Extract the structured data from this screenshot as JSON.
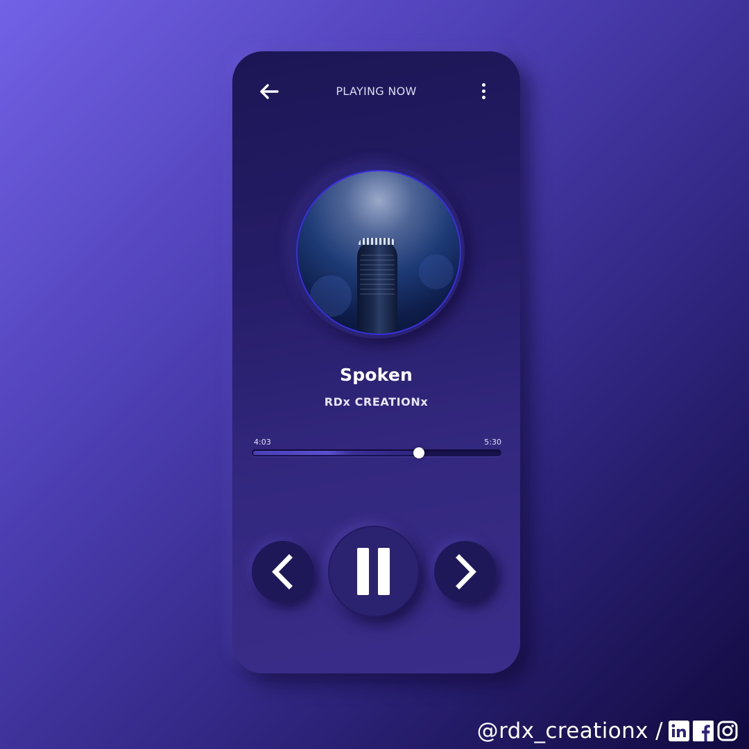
{
  "header": {
    "back_icon": "arrow-left-icon",
    "title": "PLAYING NOW",
    "menu_icon": "more-vertical-icon"
  },
  "track": {
    "title": "Spoken",
    "artist": "RDx CREATIONx",
    "art_icon": "microphone-album-art"
  },
  "progress": {
    "current": "4:03",
    "total": "5:30",
    "played_fraction": 0.67,
    "buffered_fraction": 0.33
  },
  "controls": {
    "prev_icon": "chevron-left-icon",
    "play_pause_icon": "pause-icon",
    "next_icon": "chevron-right-icon"
  },
  "footer": {
    "handle": "@rdx_creationx /",
    "social_icons": [
      "linkedin-icon",
      "facebook-icon",
      "instagram-icon"
    ]
  },
  "colors": {
    "background_start": "#7262e6",
    "background_end": "#110a3f",
    "phone": "#261d68",
    "accent": "#ffffff"
  }
}
